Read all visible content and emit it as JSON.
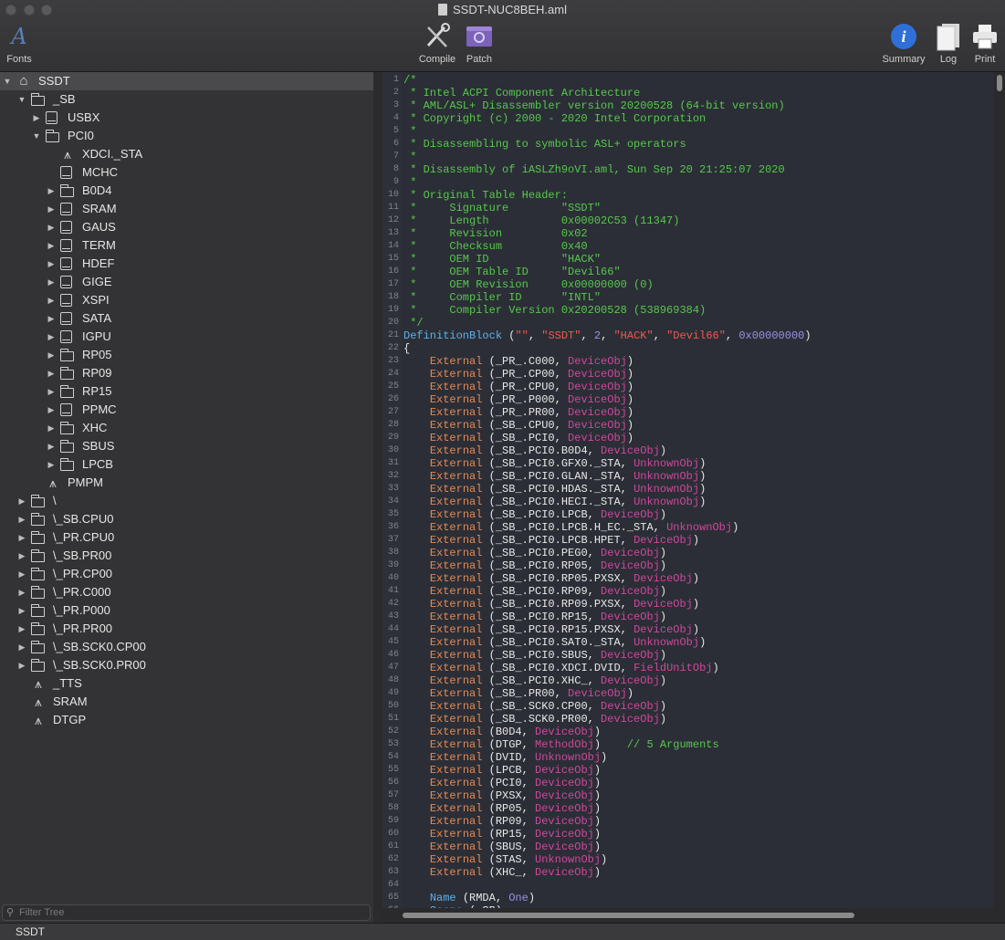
{
  "window": {
    "title": "SSDT-NUC8BEH.aml"
  },
  "toolbar": {
    "fonts_label": "Fonts",
    "compile_label": "Compile",
    "patch_label": "Patch",
    "summary_label": "Summary",
    "log_label": "Log",
    "print_label": "Print"
  },
  "tree": [
    {
      "label": "SSDT",
      "depth": 0,
      "icon": "home",
      "disclosure": "open",
      "selected": true
    },
    {
      "label": "_SB",
      "depth": 1,
      "icon": "folder",
      "disclosure": "open"
    },
    {
      "label": "USBX",
      "depth": 2,
      "icon": "device",
      "disclosure": "closed"
    },
    {
      "label": "PCI0",
      "depth": 2,
      "icon": "folder",
      "disclosure": "open"
    },
    {
      "label": "XDCI._STA",
      "depth": 3,
      "icon": "method",
      "disclosure": "none"
    },
    {
      "label": "MCHC",
      "depth": 3,
      "icon": "device",
      "disclosure": "none"
    },
    {
      "label": "B0D4",
      "depth": 3,
      "icon": "folder",
      "disclosure": "closed"
    },
    {
      "label": "SRAM",
      "depth": 3,
      "icon": "device",
      "disclosure": "closed"
    },
    {
      "label": "GAUS",
      "depth": 3,
      "icon": "device",
      "disclosure": "closed"
    },
    {
      "label": "TERM",
      "depth": 3,
      "icon": "device",
      "disclosure": "closed"
    },
    {
      "label": "HDEF",
      "depth": 3,
      "icon": "device",
      "disclosure": "closed"
    },
    {
      "label": "GIGE",
      "depth": 3,
      "icon": "device",
      "disclosure": "closed"
    },
    {
      "label": "XSPI",
      "depth": 3,
      "icon": "device",
      "disclosure": "closed"
    },
    {
      "label": "SATA",
      "depth": 3,
      "icon": "device",
      "disclosure": "closed"
    },
    {
      "label": "IGPU",
      "depth": 3,
      "icon": "device",
      "disclosure": "closed"
    },
    {
      "label": "RP05",
      "depth": 3,
      "icon": "folder",
      "disclosure": "closed"
    },
    {
      "label": "RP09",
      "depth": 3,
      "icon": "folder",
      "disclosure": "closed"
    },
    {
      "label": "RP15",
      "depth": 3,
      "icon": "folder",
      "disclosure": "closed"
    },
    {
      "label": "PPMC",
      "depth": 3,
      "icon": "device",
      "disclosure": "closed"
    },
    {
      "label": "XHC",
      "depth": 3,
      "icon": "folder",
      "disclosure": "closed"
    },
    {
      "label": "SBUS",
      "depth": 3,
      "icon": "folder",
      "disclosure": "closed"
    },
    {
      "label": "LPCB",
      "depth": 3,
      "icon": "folder",
      "disclosure": "closed"
    },
    {
      "label": "PMPM",
      "depth": 2,
      "icon": "method",
      "disclosure": "none"
    },
    {
      "label": "\\",
      "depth": 1,
      "icon": "folder",
      "disclosure": "closed"
    },
    {
      "label": "\\_SB.CPU0",
      "depth": 1,
      "icon": "folder",
      "disclosure": "closed"
    },
    {
      "label": "\\_PR.CPU0",
      "depth": 1,
      "icon": "folder",
      "disclosure": "closed"
    },
    {
      "label": "\\_SB.PR00",
      "depth": 1,
      "icon": "folder",
      "disclosure": "closed"
    },
    {
      "label": "\\_PR.CP00",
      "depth": 1,
      "icon": "folder",
      "disclosure": "closed"
    },
    {
      "label": "\\_PR.C000",
      "depth": 1,
      "icon": "folder",
      "disclosure": "closed"
    },
    {
      "label": "\\_PR.P000",
      "depth": 1,
      "icon": "folder",
      "disclosure": "closed"
    },
    {
      "label": "\\_PR.PR00",
      "depth": 1,
      "icon": "folder",
      "disclosure": "closed"
    },
    {
      "label": "\\_SB.SCK0.CP00",
      "depth": 1,
      "icon": "folder",
      "disclosure": "closed"
    },
    {
      "label": "\\_SB.SCK0.PR00",
      "depth": 1,
      "icon": "folder",
      "disclosure": "closed"
    },
    {
      "label": "_TTS",
      "depth": 1,
      "icon": "method",
      "disclosure": "none"
    },
    {
      "label": "SRAM",
      "depth": 1,
      "icon": "method",
      "disclosure": "none"
    },
    {
      "label": "DTGP",
      "depth": 1,
      "icon": "method",
      "disclosure": "none"
    }
  ],
  "filter": {
    "placeholder": "Filter Tree"
  },
  "status": {
    "text": "SSDT"
  },
  "code_lines": [
    [
      [
        "cm",
        "/*"
      ]
    ],
    [
      [
        "cm",
        " * Intel ACPI Component Architecture"
      ]
    ],
    [
      [
        "cm",
        " * AML/ASL+ Disassembler version 20200528 (64-bit version)"
      ]
    ],
    [
      [
        "cm",
        " * Copyright (c) 2000 - 2020 Intel Corporation"
      ]
    ],
    [
      [
        "cm",
        " *"
      ]
    ],
    [
      [
        "cm",
        " * Disassembling to symbolic ASL+ operators"
      ]
    ],
    [
      [
        "cm",
        " *"
      ]
    ],
    [
      [
        "cm",
        " * Disassembly of iASLZh9oVI.aml, Sun Sep 20 21:25:07 2020"
      ]
    ],
    [
      [
        "cm",
        " *"
      ]
    ],
    [
      [
        "cm",
        " * Original Table Header:"
      ]
    ],
    [
      [
        "cm",
        " *     Signature        \"SSDT\""
      ]
    ],
    [
      [
        "cm",
        " *     Length           0x00002C53 (11347)"
      ]
    ],
    [
      [
        "cm",
        " *     Revision         0x02"
      ]
    ],
    [
      [
        "cm",
        " *     Checksum         0x40"
      ]
    ],
    [
      [
        "cm",
        " *     OEM ID           \"HACK\""
      ]
    ],
    [
      [
        "cm",
        " *     OEM Table ID     \"Devil66\""
      ]
    ],
    [
      [
        "cm",
        " *     OEM Revision     0x00000000 (0)"
      ]
    ],
    [
      [
        "cm",
        " *     Compiler ID      \"INTL\""
      ]
    ],
    [
      [
        "cm",
        " *     Compiler Version 0x20200528 (538969384)"
      ]
    ],
    [
      [
        "cm",
        " */"
      ]
    ],
    [
      [
        "kw",
        "DefinitionBlock"
      ],
      [
        "tx",
        " ("
      ],
      [
        "str",
        "\"\""
      ],
      [
        "tx",
        ", "
      ],
      [
        "str",
        "\"SSDT\""
      ],
      [
        "tx",
        ", "
      ],
      [
        "num",
        "2"
      ],
      [
        "tx",
        ", "
      ],
      [
        "str",
        "\"HACK\""
      ],
      [
        "tx",
        ", "
      ],
      [
        "str",
        "\"Devil66\""
      ],
      [
        "tx",
        ", "
      ],
      [
        "num",
        "0x00000000"
      ],
      [
        "tx",
        ")"
      ]
    ],
    [
      [
        "tx",
        "{"
      ]
    ],
    [
      [
        "tx",
        "    "
      ],
      [
        "ext",
        "External"
      ],
      [
        "tx",
        " (_PR_.C000, "
      ],
      [
        "obj",
        "DeviceObj"
      ],
      [
        "tx",
        ")"
      ]
    ],
    [
      [
        "tx",
        "    "
      ],
      [
        "ext",
        "External"
      ],
      [
        "tx",
        " (_PR_.CP00, "
      ],
      [
        "obj",
        "DeviceObj"
      ],
      [
        "tx",
        ")"
      ]
    ],
    [
      [
        "tx",
        "    "
      ],
      [
        "ext",
        "External"
      ],
      [
        "tx",
        " (_PR_.CPU0, "
      ],
      [
        "obj",
        "DeviceObj"
      ],
      [
        "tx",
        ")"
      ]
    ],
    [
      [
        "tx",
        "    "
      ],
      [
        "ext",
        "External"
      ],
      [
        "tx",
        " (_PR_.P000, "
      ],
      [
        "obj",
        "DeviceObj"
      ],
      [
        "tx",
        ")"
      ]
    ],
    [
      [
        "tx",
        "    "
      ],
      [
        "ext",
        "External"
      ],
      [
        "tx",
        " (_PR_.PR00, "
      ],
      [
        "obj",
        "DeviceObj"
      ],
      [
        "tx",
        ")"
      ]
    ],
    [
      [
        "tx",
        "    "
      ],
      [
        "ext",
        "External"
      ],
      [
        "tx",
        " (_SB_.CPU0, "
      ],
      [
        "obj",
        "DeviceObj"
      ],
      [
        "tx",
        ")"
      ]
    ],
    [
      [
        "tx",
        "    "
      ],
      [
        "ext",
        "External"
      ],
      [
        "tx",
        " (_SB_.PCI0, "
      ],
      [
        "obj",
        "DeviceObj"
      ],
      [
        "tx",
        ")"
      ]
    ],
    [
      [
        "tx",
        "    "
      ],
      [
        "ext",
        "External"
      ],
      [
        "tx",
        " (_SB_.PCI0.B0D4, "
      ],
      [
        "obj",
        "DeviceObj"
      ],
      [
        "tx",
        ")"
      ]
    ],
    [
      [
        "tx",
        "    "
      ],
      [
        "ext",
        "External"
      ],
      [
        "tx",
        " (_SB_.PCI0.GFX0._STA, "
      ],
      [
        "obj",
        "UnknownObj"
      ],
      [
        "tx",
        ")"
      ]
    ],
    [
      [
        "tx",
        "    "
      ],
      [
        "ext",
        "External"
      ],
      [
        "tx",
        " (_SB_.PCI0.GLAN._STA, "
      ],
      [
        "obj",
        "UnknownObj"
      ],
      [
        "tx",
        ")"
      ]
    ],
    [
      [
        "tx",
        "    "
      ],
      [
        "ext",
        "External"
      ],
      [
        "tx",
        " (_SB_.PCI0.HDAS._STA, "
      ],
      [
        "obj",
        "UnknownObj"
      ],
      [
        "tx",
        ")"
      ]
    ],
    [
      [
        "tx",
        "    "
      ],
      [
        "ext",
        "External"
      ],
      [
        "tx",
        " (_SB_.PCI0.HECI._STA, "
      ],
      [
        "obj",
        "UnknownObj"
      ],
      [
        "tx",
        ")"
      ]
    ],
    [
      [
        "tx",
        "    "
      ],
      [
        "ext",
        "External"
      ],
      [
        "tx",
        " (_SB_.PCI0.LPCB, "
      ],
      [
        "obj",
        "DeviceObj"
      ],
      [
        "tx",
        ")"
      ]
    ],
    [
      [
        "tx",
        "    "
      ],
      [
        "ext",
        "External"
      ],
      [
        "tx",
        " (_SB_.PCI0.LPCB.H_EC._STA, "
      ],
      [
        "obj",
        "UnknownObj"
      ],
      [
        "tx",
        ")"
      ]
    ],
    [
      [
        "tx",
        "    "
      ],
      [
        "ext",
        "External"
      ],
      [
        "tx",
        " (_SB_.PCI0.LPCB.HPET, "
      ],
      [
        "obj",
        "DeviceObj"
      ],
      [
        "tx",
        ")"
      ]
    ],
    [
      [
        "tx",
        "    "
      ],
      [
        "ext",
        "External"
      ],
      [
        "tx",
        " (_SB_.PCI0.PEG0, "
      ],
      [
        "obj",
        "DeviceObj"
      ],
      [
        "tx",
        ")"
      ]
    ],
    [
      [
        "tx",
        "    "
      ],
      [
        "ext",
        "External"
      ],
      [
        "tx",
        " (_SB_.PCI0.RP05, "
      ],
      [
        "obj",
        "DeviceObj"
      ],
      [
        "tx",
        ")"
      ]
    ],
    [
      [
        "tx",
        "    "
      ],
      [
        "ext",
        "External"
      ],
      [
        "tx",
        " (_SB_.PCI0.RP05.PXSX, "
      ],
      [
        "obj",
        "DeviceObj"
      ],
      [
        "tx",
        ")"
      ]
    ],
    [
      [
        "tx",
        "    "
      ],
      [
        "ext",
        "External"
      ],
      [
        "tx",
        " (_SB_.PCI0.RP09, "
      ],
      [
        "obj",
        "DeviceObj"
      ],
      [
        "tx",
        ")"
      ]
    ],
    [
      [
        "tx",
        "    "
      ],
      [
        "ext",
        "External"
      ],
      [
        "tx",
        " (_SB_.PCI0.RP09.PXSX, "
      ],
      [
        "obj",
        "DeviceObj"
      ],
      [
        "tx",
        ")"
      ]
    ],
    [
      [
        "tx",
        "    "
      ],
      [
        "ext",
        "External"
      ],
      [
        "tx",
        " (_SB_.PCI0.RP15, "
      ],
      [
        "obj",
        "DeviceObj"
      ],
      [
        "tx",
        ")"
      ]
    ],
    [
      [
        "tx",
        "    "
      ],
      [
        "ext",
        "External"
      ],
      [
        "tx",
        " (_SB_.PCI0.RP15.PXSX, "
      ],
      [
        "obj",
        "DeviceObj"
      ],
      [
        "tx",
        ")"
      ]
    ],
    [
      [
        "tx",
        "    "
      ],
      [
        "ext",
        "External"
      ],
      [
        "tx",
        " (_SB_.PCI0.SAT0._STA, "
      ],
      [
        "obj",
        "UnknownObj"
      ],
      [
        "tx",
        ")"
      ]
    ],
    [
      [
        "tx",
        "    "
      ],
      [
        "ext",
        "External"
      ],
      [
        "tx",
        " (_SB_.PCI0.SBUS, "
      ],
      [
        "obj",
        "DeviceObj"
      ],
      [
        "tx",
        ")"
      ]
    ],
    [
      [
        "tx",
        "    "
      ],
      [
        "ext",
        "External"
      ],
      [
        "tx",
        " (_SB_.PCI0.XDCI.DVID, "
      ],
      [
        "obj",
        "FieldUnitObj"
      ],
      [
        "tx",
        ")"
      ]
    ],
    [
      [
        "tx",
        "    "
      ],
      [
        "ext",
        "External"
      ],
      [
        "tx",
        " (_SB_.PCI0.XHC_, "
      ],
      [
        "obj",
        "DeviceObj"
      ],
      [
        "tx",
        ")"
      ]
    ],
    [
      [
        "tx",
        "    "
      ],
      [
        "ext",
        "External"
      ],
      [
        "tx",
        " (_SB_.PR00, "
      ],
      [
        "obj",
        "DeviceObj"
      ],
      [
        "tx",
        ")"
      ]
    ],
    [
      [
        "tx",
        "    "
      ],
      [
        "ext",
        "External"
      ],
      [
        "tx",
        " (_SB_.SCK0.CP00, "
      ],
      [
        "obj",
        "DeviceObj"
      ],
      [
        "tx",
        ")"
      ]
    ],
    [
      [
        "tx",
        "    "
      ],
      [
        "ext",
        "External"
      ],
      [
        "tx",
        " (_SB_.SCK0.PR00, "
      ],
      [
        "obj",
        "DeviceObj"
      ],
      [
        "tx",
        ")"
      ]
    ],
    [
      [
        "tx",
        "    "
      ],
      [
        "ext",
        "External"
      ],
      [
        "tx",
        " (B0D4, "
      ],
      [
        "obj",
        "DeviceObj"
      ],
      [
        "tx",
        ")"
      ]
    ],
    [
      [
        "tx",
        "    "
      ],
      [
        "ext",
        "External"
      ],
      [
        "tx",
        " (DTGP, "
      ],
      [
        "obj",
        "MethodObj"
      ],
      [
        "tx",
        ")    "
      ],
      [
        "cm",
        "// 5 Arguments"
      ]
    ],
    [
      [
        "tx",
        "    "
      ],
      [
        "ext",
        "External"
      ],
      [
        "tx",
        " (DVID, "
      ],
      [
        "obj",
        "UnknownObj"
      ],
      [
        "tx",
        ")"
      ]
    ],
    [
      [
        "tx",
        "    "
      ],
      [
        "ext",
        "External"
      ],
      [
        "tx",
        " (LPCB, "
      ],
      [
        "obj",
        "DeviceObj"
      ],
      [
        "tx",
        ")"
      ]
    ],
    [
      [
        "tx",
        "    "
      ],
      [
        "ext",
        "External"
      ],
      [
        "tx",
        " (PCI0, "
      ],
      [
        "obj",
        "DeviceObj"
      ],
      [
        "tx",
        ")"
      ]
    ],
    [
      [
        "tx",
        "    "
      ],
      [
        "ext",
        "External"
      ],
      [
        "tx",
        " (PXSX, "
      ],
      [
        "obj",
        "DeviceObj"
      ],
      [
        "tx",
        ")"
      ]
    ],
    [
      [
        "tx",
        "    "
      ],
      [
        "ext",
        "External"
      ],
      [
        "tx",
        " (RP05, "
      ],
      [
        "obj",
        "DeviceObj"
      ],
      [
        "tx",
        ")"
      ]
    ],
    [
      [
        "tx",
        "    "
      ],
      [
        "ext",
        "External"
      ],
      [
        "tx",
        " (RP09, "
      ],
      [
        "obj",
        "DeviceObj"
      ],
      [
        "tx",
        ")"
      ]
    ],
    [
      [
        "tx",
        "    "
      ],
      [
        "ext",
        "External"
      ],
      [
        "tx",
        " (RP15, "
      ],
      [
        "obj",
        "DeviceObj"
      ],
      [
        "tx",
        ")"
      ]
    ],
    [
      [
        "tx",
        "    "
      ],
      [
        "ext",
        "External"
      ],
      [
        "tx",
        " (SBUS, "
      ],
      [
        "obj",
        "DeviceObj"
      ],
      [
        "tx",
        ")"
      ]
    ],
    [
      [
        "tx",
        "    "
      ],
      [
        "ext",
        "External"
      ],
      [
        "tx",
        " (STAS, "
      ],
      [
        "obj",
        "UnknownObj"
      ],
      [
        "tx",
        ")"
      ]
    ],
    [
      [
        "tx",
        "    "
      ],
      [
        "ext",
        "External"
      ],
      [
        "tx",
        " (XHC_, "
      ],
      [
        "obj",
        "DeviceObj"
      ],
      [
        "tx",
        ")"
      ]
    ],
    [
      [
        "tx",
        ""
      ]
    ],
    [
      [
        "tx",
        "    "
      ],
      [
        "kw",
        "Name"
      ],
      [
        "tx",
        " (RMDA, "
      ],
      [
        "num",
        "One"
      ],
      [
        "tx",
        ")"
      ]
    ],
    [
      [
        "tx",
        "    "
      ],
      [
        "kw",
        "Scope"
      ],
      [
        "tx",
        " (_SB)"
      ]
    ],
    [
      [
        "tx",
        ""
      ]
    ]
  ],
  "colors": {
    "comment": "#56c94b",
    "keyword": "#5fb1ea",
    "external": "#e48a56",
    "object_type": "#d0479c",
    "string": "#ef5950",
    "number": "#9b8fe8"
  }
}
